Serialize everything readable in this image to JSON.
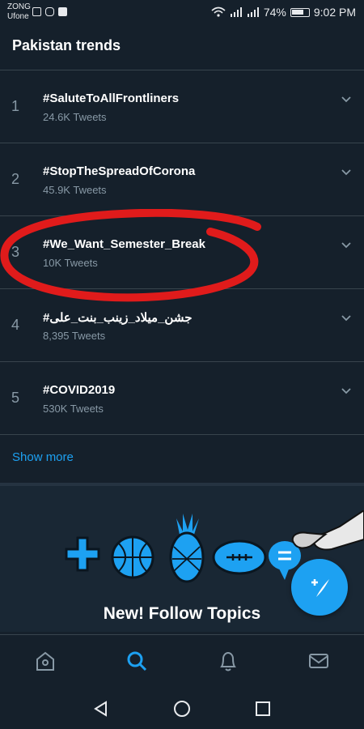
{
  "status_bar": {
    "carrier_1": "ZONG",
    "carrier_2": "Ufone",
    "battery": "74%",
    "time": "9:02 PM",
    "icons": [
      "image-icon",
      "instagram-icon",
      "facebook-icon",
      "wifi-icon",
      "signal-4g-icon",
      "signal-3g-icon",
      "battery-icon"
    ]
  },
  "header": {
    "title": "Pakistan trends"
  },
  "trends": [
    {
      "rank": "1",
      "hashtag": "#SaluteToAllFrontliners",
      "count": "24.6K Tweets"
    },
    {
      "rank": "2",
      "hashtag": "#StopTheSpreadOfCorona",
      "count": "45.9K Tweets"
    },
    {
      "rank": "3",
      "hashtag": "#We_Want_Semester_Break",
      "count": "10K Tweets"
    },
    {
      "rank": "4",
      "hashtag": "#جشن_میلاد_زینب_بنت_علی",
      "count": "8,395 Tweets"
    },
    {
      "rank": "5",
      "hashtag": "#COVID2019",
      "count": "530K Tweets"
    }
  ],
  "show_more": "Show more",
  "promo": {
    "title": "New! Follow Topics",
    "icons": [
      "gamepad-icon",
      "basketball-icon",
      "pineapple-icon",
      "football-icon",
      "chat-bubble-icon"
    ]
  },
  "bottom_nav": [
    "home-icon",
    "search-icon",
    "notifications-icon",
    "messages-icon"
  ],
  "colors": {
    "accent": "#1da1f2",
    "background": "#15202b",
    "annotation": "#e01b1b"
  }
}
